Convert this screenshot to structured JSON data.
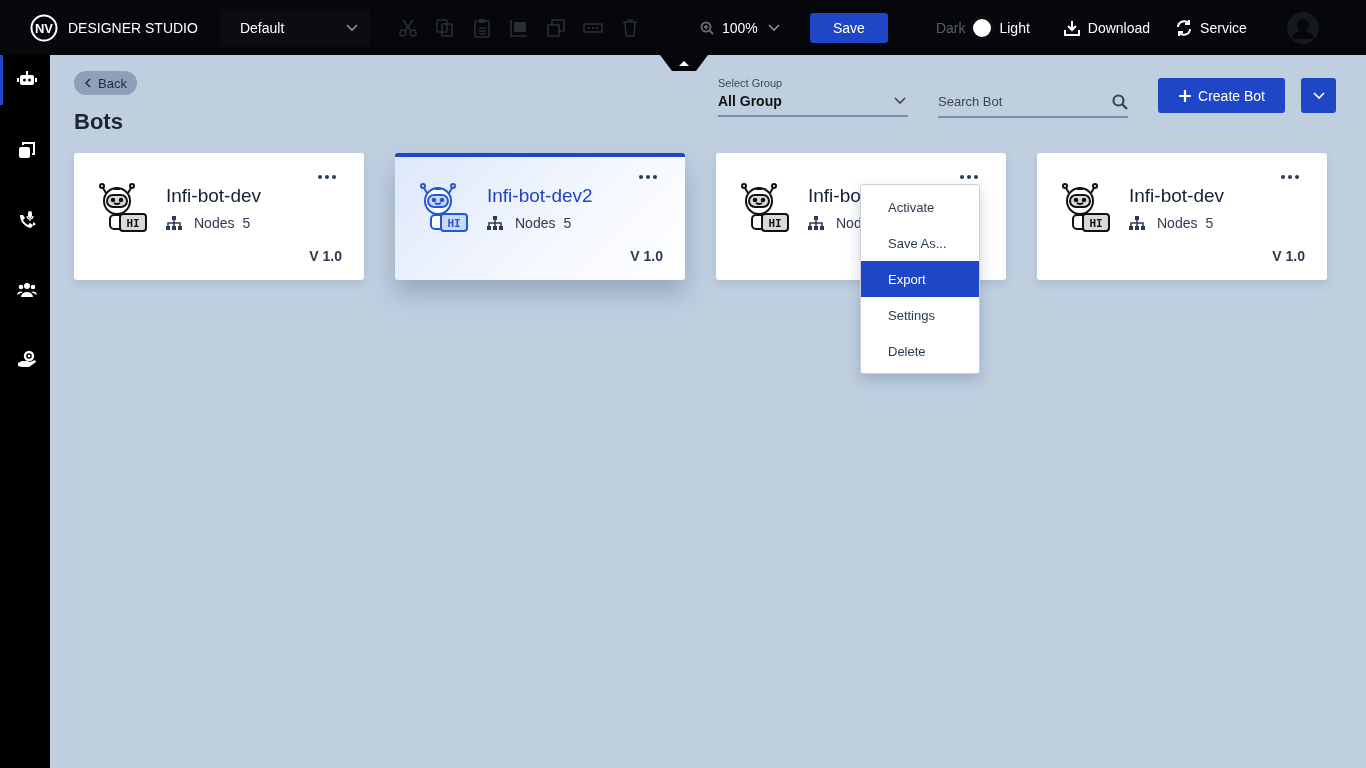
{
  "topbar": {
    "logo_mark": "NV",
    "app_name": "DESIGNER STUDIO",
    "workspace": {
      "value": "Default"
    },
    "tools": [
      {
        "kind": "cut",
        "disabled": true
      },
      {
        "kind": "copy",
        "disabled": true
      },
      {
        "kind": "paste",
        "disabled": true
      },
      {
        "kind": "frame",
        "disabled": true
      },
      {
        "kind": "layers",
        "disabled": true
      },
      {
        "kind": "input",
        "disabled": true
      },
      {
        "kind": "trash",
        "disabled": true
      }
    ],
    "zoom": "100%",
    "save": "Save",
    "theme": [
      {
        "label": "Dark",
        "selected": false
      },
      {
        "label": "Light",
        "selected": true
      }
    ],
    "download": "Download",
    "service": "Service"
  },
  "sidebar": {
    "items": [
      {
        "kind": "bot",
        "selected": true
      },
      {
        "kind": "copies",
        "selected": false
      },
      {
        "kind": "phone",
        "selected": false
      },
      {
        "kind": "users",
        "selected": false
      },
      {
        "kind": "hand",
        "selected": false
      }
    ]
  },
  "page": {
    "back": "Back",
    "title": "Bots",
    "group_select": {
      "label": "Select Group",
      "value": "All Group"
    },
    "search": {
      "placeholder": "Search Bot"
    },
    "create": "Create Bot"
  },
  "bots": [
    {
      "name": "Infi-bot-dev",
      "badge": "HI",
      "nodes_label": "Nodes",
      "nodes_count": "5",
      "version": "V 1.0",
      "selected": false
    },
    {
      "name": "Infi-bot-dev2",
      "badge": "HI",
      "nodes_label": "Nodes",
      "nodes_count": "5",
      "version": "V 1.0",
      "selected": true
    },
    {
      "name": "Infi-bo",
      "badge": "HI",
      "nodes_label": "Nod",
      "selected": false,
      "menu": [
        {
          "label": "Activate",
          "selected": false
        },
        {
          "label": "Save As...",
          "selected": false
        },
        {
          "label": "Export",
          "selected": true
        },
        {
          "label": "Settings",
          "selected": false
        },
        {
          "label": "Delete",
          "selected": false
        }
      ]
    },
    {
      "name": "Infi-bot-dev",
      "badge": "HI",
      "nodes_label": "Nodes",
      "nodes_count": "5",
      "version": "V 1.0",
      "selected": false
    }
  ]
}
